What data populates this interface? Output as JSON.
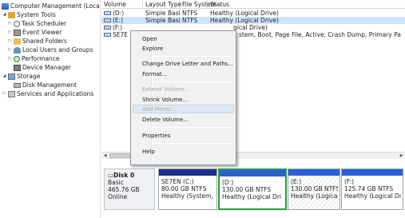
{
  "tree": {
    "root": "Computer Management (Local",
    "system_tools": "System Tools",
    "task_scheduler": "Task Scheduler",
    "event_viewer": "Event Viewer",
    "shared_folders": "Shared Folders",
    "local_users": "Local Users and Groups",
    "performance": "Performance",
    "device_manager": "Device Manager",
    "storage": "Storage",
    "disk_management": "Disk Management",
    "services": "Services and Applications"
  },
  "list": {
    "headers": {
      "volume": "Volume",
      "layout": "Layout",
      "type": "Type",
      "fs": "File System",
      "status": "Status"
    },
    "rows": [
      {
        "volume": "(D:)",
        "layout": "Simple",
        "type": "Basic",
        "fs": "NTFS",
        "status": "Healthy (Logical Drive)"
      },
      {
        "volume": "(E:)",
        "layout": "Simple",
        "type": "Basic",
        "fs": "NTFS",
        "status": "Healthy (Logical Drive)"
      },
      {
        "volume": "(F:)",
        "layout": "",
        "type": "",
        "fs": "",
        "status": "gical Drive)"
      },
      {
        "volume": "SE7E",
        "layout": "",
        "type": "",
        "fs": "",
        "status": "stem, Boot, Page File, Active, Crash Dump, Primary Pa"
      }
    ]
  },
  "context_menu": {
    "open": "Open",
    "explore": "Explore",
    "change_letter": "Change Drive Letter and Paths...",
    "format": "Format...",
    "extend": "Extend Volume...",
    "shrink": "Shrink Volume...",
    "add_mirror": "Add Mirror...",
    "delete": "Delete Volume...",
    "properties": "Properties",
    "help": "Help"
  },
  "disk": {
    "name": "Disk 0",
    "type": "Basic",
    "size": "465.76 GB",
    "status": "Online",
    "partitions": [
      {
        "name": "SE7EN (C:)",
        "size": "80.00 GB NTFS",
        "status": "Healthy (System, Bc"
      },
      {
        "name": "(D:)",
        "size": "130.00 GB NTFS",
        "status": "Healthy (Logical Dri"
      },
      {
        "name": "(E:)",
        "size": "130.00 GB NTFS",
        "status": "Healthy (Logical Dri"
      },
      {
        "name": "(F:)",
        "size": "125.74 GB NTFS",
        "status": "Healthy (Logical Dri"
      }
    ]
  },
  "colors": {
    "primary_bar": "#1c2f8c",
    "extended_border": "#2d9a3a",
    "selection": "#cde4fa"
  }
}
